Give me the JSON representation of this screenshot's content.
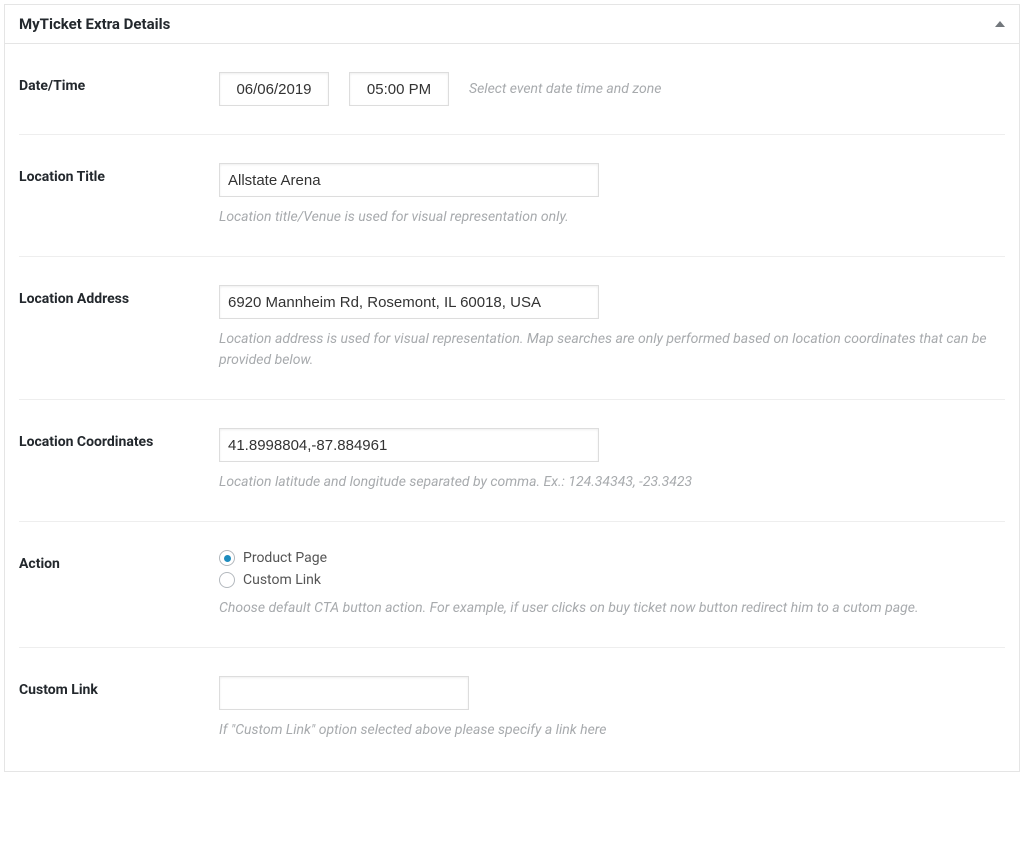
{
  "panel": {
    "title": "MyTicket Extra Details"
  },
  "fields": {
    "datetime": {
      "label": "Date/Time",
      "date_value": "06/06/2019",
      "time_value": "05:00 PM",
      "hint": "Select event date time and zone"
    },
    "location_title": {
      "label": "Location Title",
      "value": "Allstate Arena",
      "hint": "Location title/Venue is used for visual representation only."
    },
    "location_address": {
      "label": "Location Address",
      "value": "6920 Mannheim Rd, Rosemont, IL 60018, USA",
      "hint": "Location address is used for visual representation. Map searches are only performed based on location coordinates that can be provided below."
    },
    "location_coordinates": {
      "label": "Location Coordinates",
      "value": "41.8998804,-87.884961",
      "hint": "Location latitude and longitude separated by comma. Ex.: 124.34343, -23.3423"
    },
    "action": {
      "label": "Action",
      "option_product": "Product Page",
      "option_custom": "Custom Link",
      "hint": "Choose default CTA button action. For example, if user clicks on buy ticket now button redirect him to a cutom page."
    },
    "custom_link": {
      "label": "Custom Link",
      "value": "",
      "hint": "If \"Custom Link\" option selected above please specify a link here"
    }
  }
}
